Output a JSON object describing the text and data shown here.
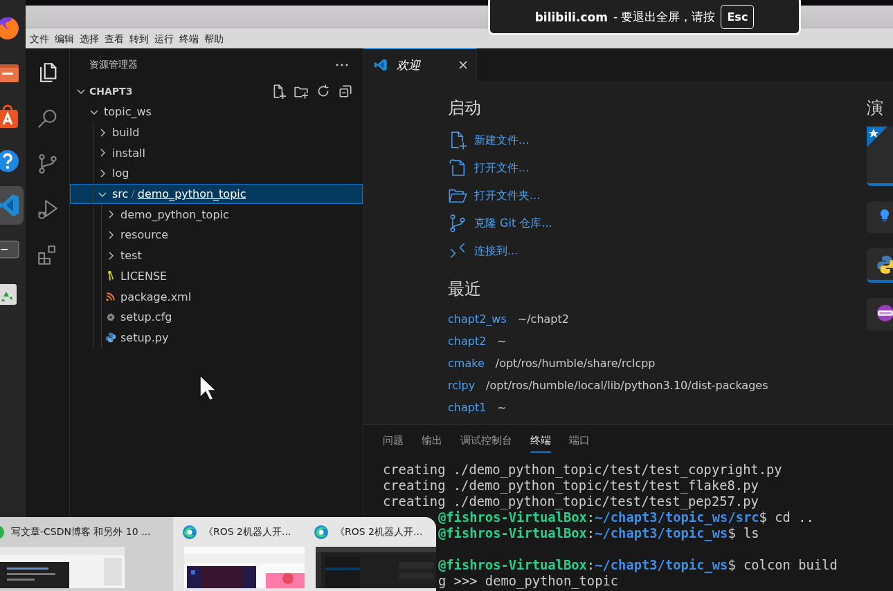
{
  "fullscreen_hint": {
    "site": "bilibili.com",
    "message": "- 要退出全屏，请按",
    "key": "Esc"
  },
  "dock": [
    {
      "kind": "browser",
      "active": false
    },
    {
      "kind": "files",
      "active": false
    },
    {
      "kind": "store",
      "active": false
    },
    {
      "kind": "help",
      "active": false
    },
    {
      "kind": "editor",
      "active": true
    },
    {
      "kind": "terminal",
      "active": false
    },
    {
      "kind": "trash",
      "active": false
    }
  ],
  "menu_bar": [
    "文件",
    "编辑",
    "选择",
    "查看",
    "转到",
    "运行",
    "终端",
    "帮助"
  ],
  "activity_bar": [
    {
      "kind": "explorer",
      "selected": true
    },
    {
      "kind": "search",
      "selected": false
    },
    {
      "kind": "source_control",
      "selected": false
    },
    {
      "kind": "run_debug",
      "selected": false
    },
    {
      "kind": "extensions",
      "selected": false
    }
  ],
  "explorer": {
    "title": "资源管理器",
    "section": {
      "label": "CHAPT3",
      "expanded": true
    },
    "tree": [
      {
        "label": "topic_ws",
        "kind": "folder",
        "expanded": true,
        "selected": false,
        "children": [
          {
            "label": "build",
            "kind": "folder",
            "expanded": false,
            "selected": false
          },
          {
            "label": "install",
            "kind": "folder",
            "expanded": false,
            "selected": false
          },
          {
            "label": "log",
            "kind": "folder",
            "expanded": false,
            "selected": false
          },
          {
            "parts": [
              "src",
              "/",
              "demo_python_topic"
            ],
            "kind": "folder",
            "expanded": true,
            "selected": true,
            "children": [
              {
                "label": "demo_python_topic",
                "kind": "folder",
                "expanded": false,
                "selected": false
              },
              {
                "label": "resource",
                "kind": "folder",
                "expanded": false,
                "selected": false
              },
              {
                "label": "test",
                "kind": "folder",
                "expanded": false,
                "selected": false
              },
              {
                "label": "LICENSE",
                "kind": "license",
                "selected": false
              },
              {
                "label": "package.xml",
                "kind": "xml",
                "selected": false
              },
              {
                "label": "setup.cfg",
                "kind": "config",
                "selected": false
              },
              {
                "label": "setup.py",
                "kind": "python",
                "selected": false
              }
            ]
          }
        ]
      }
    ]
  },
  "editor_tabs": [
    {
      "label": "欢迎",
      "selected": true
    }
  ],
  "welcome": {
    "start_heading": "启动",
    "start_items": [
      {
        "kind": "new_file",
        "label": "新建文件..."
      },
      {
        "kind": "open_file",
        "label": "打开文件..."
      },
      {
        "kind": "open_folder",
        "label": "打开文件夹..."
      },
      {
        "kind": "clone",
        "label": "克隆 Git 仓库..."
      },
      {
        "kind": "connect",
        "label": "连接到..."
      }
    ],
    "recent_heading": "最近",
    "recent": [
      {
        "name": "chapt2_ws",
        "path": "~/chapt2"
      },
      {
        "name": "chapt2",
        "path": "~"
      },
      {
        "name": "cmake",
        "path": "/opt/ros/humble/share/rclcpp"
      },
      {
        "name": "rclpy",
        "path": "/opt/ros/humble/local/lib/python3.10/dist-packages"
      },
      {
        "name": "chapt1",
        "path": "~"
      }
    ],
    "walkthrough_heading": "演",
    "walkthroughs": [
      {
        "kind": "featured",
        "started": true
      },
      {
        "kind": "tip",
        "started": false
      },
      {
        "kind": "python",
        "started": true
      },
      {
        "kind": "cpp",
        "started": false
      }
    ]
  },
  "panel": {
    "tabs": [
      {
        "label": "问题",
        "selected": false
      },
      {
        "label": "输出",
        "selected": false
      },
      {
        "label": "调试控制台",
        "selected": false
      },
      {
        "label": "终端",
        "selected": true
      },
      {
        "label": "端口",
        "selected": false
      }
    ],
    "terminal": [
      {
        "kind": "output",
        "text": "creating ./demo_python_topic/test/test_copyright.py"
      },
      {
        "kind": "output",
        "text": "creating ./demo_python_topic/test/test_flake8.py"
      },
      {
        "kind": "output",
        "text": "creating ./demo_python_topic/test/test_pep257.py"
      },
      {
        "kind": "prompt",
        "host": "@fishros-VirtualBox",
        "colon": ":",
        "path": "~/chapt3/topic_ws/src",
        "command": "$ cd .."
      },
      {
        "kind": "prompt",
        "host": "@fishros-VirtualBox",
        "colon": ":",
        "path": "~/chapt3/topic_ws",
        "command": "$ ls"
      },
      {
        "kind": "blank"
      },
      {
        "kind": "prompt",
        "host": "@fishros-VirtualBox",
        "colon": ":",
        "path": "~/chapt3/topic_ws",
        "command": "$ colcon build"
      },
      {
        "kind": "covered",
        "text": "g >>> demo_python_topic"
      }
    ]
  },
  "task_switcher": [
    {
      "title": "写文章-CSDN博客 和另外 10 ...",
      "kind": "browser",
      "selected": true
    },
    {
      "title": "《ROS 2机器人开...",
      "kind": "edge",
      "selected": false
    },
    {
      "title": "《ROS 2机器人开...",
      "kind": "edge",
      "selected": false
    }
  ]
}
